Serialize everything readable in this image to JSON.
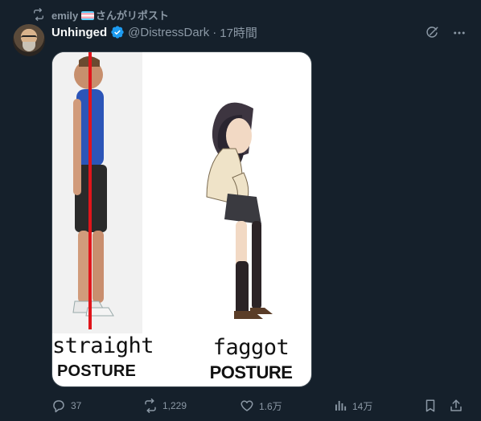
{
  "repost": {
    "user": "emily",
    "suffix": "さんがリポスト"
  },
  "tweet": {
    "display_name": "Unhinged",
    "handle": "@DistressDark",
    "separator": "·",
    "time": "17時間"
  },
  "media": {
    "left_caption_top": "straight",
    "left_caption_bottom": "POSTURE",
    "right_caption_top": "faggot",
    "right_caption_bottom": "POSTURE"
  },
  "actions": {
    "replies": "37",
    "reposts": "1,229",
    "likes": "1.6万",
    "views": "14万"
  },
  "colors": {
    "background": "#15202b",
    "secondary_text": "#8b98a5",
    "verified_blue": "#1d9bf0",
    "primary_text": "#f7f9f9"
  },
  "icons": [
    "repost-icon",
    "verified-icon",
    "grok-icon",
    "more-icon",
    "reply-icon",
    "like-icon",
    "views-icon",
    "bookmark-icon",
    "share-icon"
  ]
}
